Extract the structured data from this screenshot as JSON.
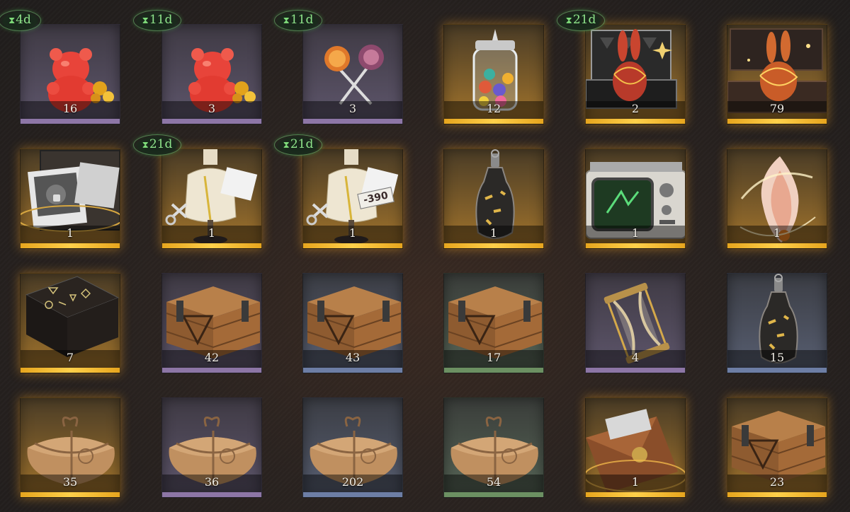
{
  "items": [
    {
      "name": "red-gummy-bear",
      "count": "16",
      "rarity": "purple",
      "timer": "4d",
      "icon": "gummy-bear"
    },
    {
      "name": "red-gummy-bear",
      "count": "3",
      "rarity": "purple",
      "timer": "11d",
      "icon": "gummy-bear"
    },
    {
      "name": "lollipops",
      "count": "3",
      "rarity": "purple",
      "timer": "11d",
      "icon": "lollipop"
    },
    {
      "name": "candy-jar",
      "count": "12",
      "rarity": "gold",
      "timer": "",
      "icon": "jar"
    },
    {
      "name": "rabbit-case",
      "count": "2",
      "rarity": "gold",
      "timer": "21d",
      "icon": "rabbit-case"
    },
    {
      "name": "rabbit-chest",
      "count": "79",
      "rarity": "gold",
      "timer": "",
      "icon": "rabbit-chest"
    },
    {
      "name": "photo-box",
      "count": "1",
      "rarity": "gold",
      "timer": "",
      "icon": "photo-box"
    },
    {
      "name": "tailor-mannequin-portrait",
      "count": "1",
      "rarity": "gold",
      "timer": "21d",
      "icon": "mannequin"
    },
    {
      "name": "tailor-mannequin-coupon",
      "count": "1",
      "rarity": "gold",
      "timer": "21d",
      "icon": "mannequin"
    },
    {
      "name": "message-bottle",
      "count": "1",
      "rarity": "gold",
      "timer": "",
      "icon": "bottle"
    },
    {
      "name": "old-tv",
      "count": "1",
      "rarity": "gold",
      "timer": "",
      "icon": "tv"
    },
    {
      "name": "spirit-flame",
      "count": "1",
      "rarity": "gold",
      "timer": "",
      "icon": "flame"
    },
    {
      "name": "rune-table",
      "count": "7",
      "rarity": "gold",
      "timer": "",
      "icon": "table"
    },
    {
      "name": "wooden-crate",
      "count": "42",
      "rarity": "purple",
      "timer": "",
      "icon": "crate"
    },
    {
      "name": "wooden-crate",
      "count": "43",
      "rarity": "blue",
      "timer": "",
      "icon": "crate"
    },
    {
      "name": "wooden-crate",
      "count": "17",
      "rarity": "green",
      "timer": "",
      "icon": "crate"
    },
    {
      "name": "hourglass",
      "count": "4",
      "rarity": "purple",
      "timer": "",
      "icon": "hourglass"
    },
    {
      "name": "message-bottle",
      "count": "15",
      "rarity": "blue",
      "timer": "",
      "icon": "bottle"
    },
    {
      "name": "tied-package",
      "count": "35",
      "rarity": "gold",
      "timer": "",
      "icon": "package"
    },
    {
      "name": "tied-package",
      "count": "36",
      "rarity": "purple",
      "timer": "",
      "icon": "package"
    },
    {
      "name": "tied-package",
      "count": "202",
      "rarity": "blue",
      "timer": "",
      "icon": "package"
    },
    {
      "name": "tied-package",
      "count": "54",
      "rarity": "green",
      "timer": "",
      "icon": "package"
    },
    {
      "name": "sealed-envelope",
      "count": "1",
      "rarity": "gold",
      "timer": "",
      "icon": "envelope"
    },
    {
      "name": "wooden-crate",
      "count": "23",
      "rarity": "gold",
      "timer": "",
      "icon": "crate"
    }
  ],
  "coupon_label": "-390"
}
